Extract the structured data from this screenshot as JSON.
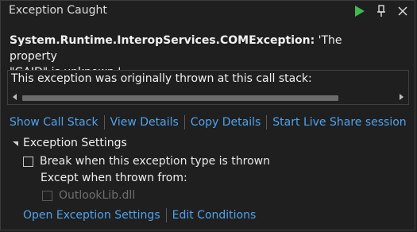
{
  "window": {
    "title": "Exception Caught"
  },
  "exception": {
    "type": "System.Runtime.InteropServices.COMException:",
    "message_line1": " 'The property",
    "message_line2": "\"GAID\" is unknown.'"
  },
  "stack": {
    "text": "This exception was originally thrown at this call stack:"
  },
  "links": {
    "show_call_stack": "Show Call Stack",
    "view_details": "View Details",
    "copy_details": "Copy Details",
    "live_share": "Start Live Share session"
  },
  "settings": {
    "header": "Exception Settings",
    "break_when_thrown": "Break when this exception type is thrown",
    "except_when": "Except when thrown from:",
    "module": "OutlookLib.dll",
    "open_settings": "Open Exception Settings",
    "edit_conditions": "Edit Conditions"
  },
  "colors": {
    "background": "#1f1f1f",
    "link": "#4ea3ef",
    "continue_green": "#3fb950"
  },
  "icons": {
    "continue": "play-icon",
    "pin": "pin-icon",
    "close": "close-icon",
    "scroll_left": "chevron-left-icon",
    "scroll_right": "chevron-right-icon",
    "collapse": "caret-down-icon"
  }
}
